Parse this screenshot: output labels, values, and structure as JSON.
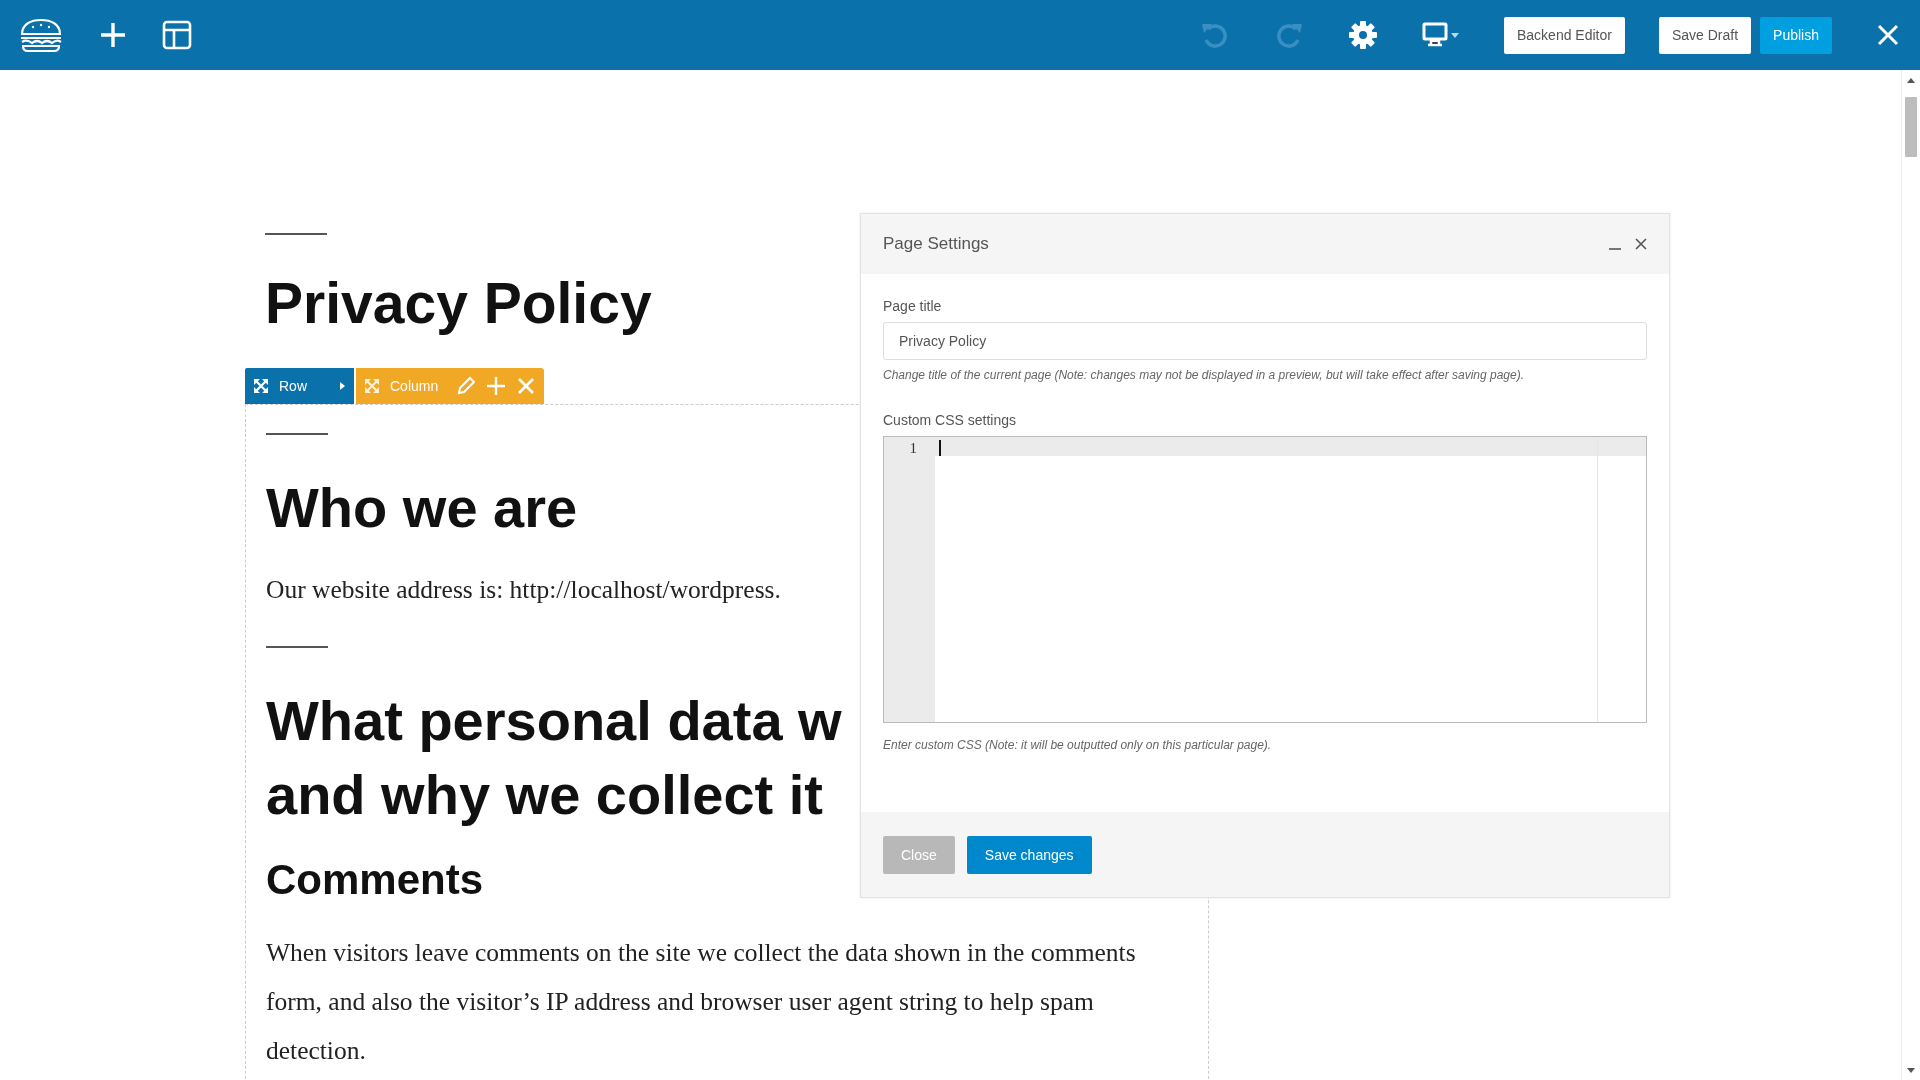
{
  "toolbar": {
    "history": [
      {
        "kind": "undo",
        "disabled": true
      },
      {
        "kind": "redo",
        "disabled": true
      }
    ],
    "buttons": [
      {
        "label": "Backend Editor",
        "kind": "plain"
      },
      {
        "label": "Save Draft",
        "kind": "plain"
      },
      {
        "label": "Publish",
        "kind": "primary"
      }
    ]
  },
  "page": {
    "title": "Privacy Policy",
    "row_controls": {
      "row": {
        "label": "Row"
      },
      "column": {
        "label": "Column"
      }
    },
    "blocks": [
      {
        "kind": "rule"
      },
      {
        "kind": "h2",
        "lines": [
          "Who we are"
        ]
      },
      {
        "kind": "p",
        "text": "Our website address is: http://localhost/wordpress."
      },
      {
        "kind": "rule"
      },
      {
        "kind": "h2",
        "lines": [
          "What personal data w",
          "and why we collect it"
        ]
      },
      {
        "kind": "h3",
        "lines": [
          "Comments"
        ]
      },
      {
        "kind": "p",
        "text": "When visitors leave comments on the site we collect the data shown in the comments form, and also the visitor’s IP address and browser user agent string to help spam detection."
      }
    ]
  },
  "dialog": {
    "title": "Page Settings",
    "page_title": {
      "label": "Page title",
      "value": "Privacy Policy",
      "hint": "Change title of the current page (Note: changes may not be displayed in a preview, but will take effect after saving page)."
    },
    "custom_css": {
      "label": "Custom CSS settings",
      "line_numbers": [
        "1"
      ],
      "hint": "Enter custom CSS (Note: it will be outputted only on this particular page)."
    },
    "buttons": [
      {
        "label": "Close",
        "kind": "secondary"
      },
      {
        "label": "Save changes",
        "kind": "primary"
      }
    ]
  }
}
